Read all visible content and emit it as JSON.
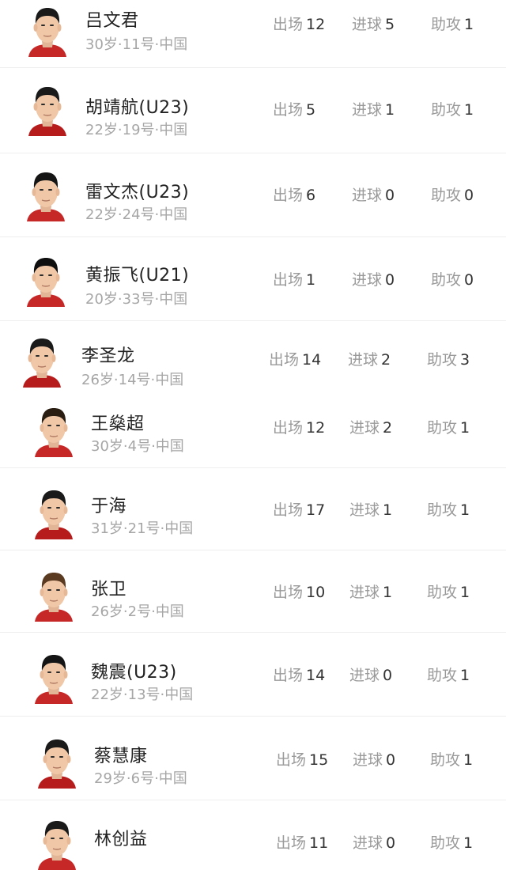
{
  "stat_labels": {
    "apps": "出场",
    "goals": "进球",
    "assists": "助攻"
  },
  "players": [
    {
      "name": "吕文君",
      "meta": "30岁·11号·中国",
      "apps": "12",
      "goals": "5",
      "assists": "1"
    },
    {
      "name": "胡靖航(U23)",
      "meta": "22岁·19号·中国",
      "apps": "5",
      "goals": "1",
      "assists": "1"
    },
    {
      "name": "雷文杰(U23)",
      "meta": "22岁·24号·中国",
      "apps": "6",
      "goals": "0",
      "assists": "0"
    },
    {
      "name": "黄振飞(U21)",
      "meta": "20岁·33号·中国",
      "apps": "1",
      "goals": "0",
      "assists": "0"
    },
    {
      "name": "李圣龙",
      "meta": "26岁·14号·中国",
      "apps": "14",
      "goals": "2",
      "assists": "3"
    },
    {
      "name": "王燊超",
      "meta": "30岁·4号·中国",
      "apps": "12",
      "goals": "2",
      "assists": "1"
    },
    {
      "name": "于海",
      "meta": "31岁·21号·中国",
      "apps": "17",
      "goals": "1",
      "assists": "1"
    },
    {
      "name": "张卫",
      "meta": "26岁·2号·中国",
      "apps": "10",
      "goals": "1",
      "assists": "1"
    },
    {
      "name": "魏震(U23)",
      "meta": "22岁·13号·中国",
      "apps": "14",
      "goals": "0",
      "assists": "1"
    },
    {
      "name": "蔡慧康",
      "meta": "29岁·6号·中国",
      "apps": "15",
      "goals": "0",
      "assists": "1"
    },
    {
      "name": "林创益",
      "meta": "",
      "apps": "11",
      "goals": "0",
      "assists": "1"
    }
  ]
}
